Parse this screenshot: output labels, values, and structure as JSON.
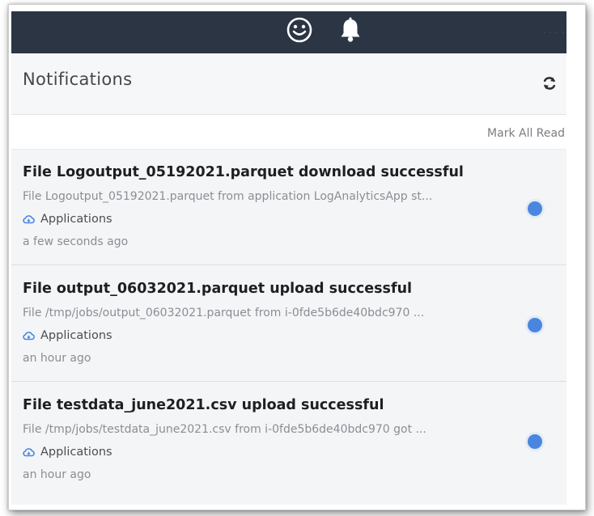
{
  "header": {
    "title": "Notifications",
    "mark_all_read": "Mark All Read"
  },
  "topbar": {
    "icons": [
      "smiley-icon",
      "bell-icon"
    ],
    "background": "#2c3544"
  },
  "accent_unread": "#4a86e0",
  "notifications": [
    {
      "title": "File Logoutput_05192021.parquet download successful",
      "description": "File Logoutput_05192021.parquet from application LogAnalyticsApp st...",
      "source": "Applications",
      "time": "a few seconds ago",
      "unread": true
    },
    {
      "title": "File output_06032021.parquet upload successful",
      "description": "File /tmp/jobs/output_06032021.parquet from i-0fde5b6de40bdc970 ...",
      "source": "Applications",
      "time": "an hour ago",
      "unread": true
    },
    {
      "title": "File testdata_june2021.csv upload successful",
      "description": "File /tmp/jobs/testdata_june2021.csv from i-0fde5b6de40bdc970 got ...",
      "source": "Applications",
      "time": "an hour ago",
      "unread": true
    }
  ]
}
